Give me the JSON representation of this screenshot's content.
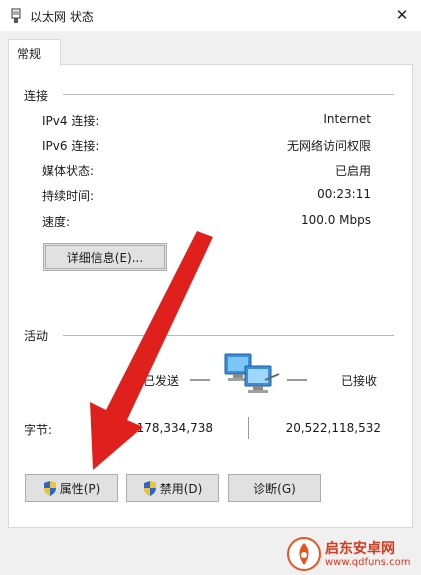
{
  "window": {
    "title": "以太网 状态",
    "close_glyph": "✕"
  },
  "tabs": [
    {
      "label": "常规"
    }
  ],
  "connection": {
    "heading": "连接",
    "rows": [
      {
        "label": "IPv4 连接:",
        "value": "Internet"
      },
      {
        "label": "IPv6 连接:",
        "value": "无网络访问权限"
      },
      {
        "label": "媒体状态:",
        "value": "已启用"
      },
      {
        "label": "持续时间:",
        "value": "00:23:11"
      },
      {
        "label": "速度:",
        "value": "100.0 Mbps"
      }
    ],
    "details_button": "详细信息(E)..."
  },
  "activity": {
    "heading": "活动",
    "sent_label": "已发送",
    "received_label": "已接收",
    "bytes_label": "字节:",
    "bytes_sent": "9,178,334,738",
    "bytes_received": "20,522,118,532"
  },
  "buttons": {
    "properties": "属性(P)",
    "disable": "禁用(D)",
    "diagnose": "诊断(G)"
  },
  "icons": {
    "title": "network-adapter-icon",
    "activity": "network-computers-icon",
    "shield": "uac-shield-icon"
  },
  "annotation": {
    "arrow_color": "#e0201c"
  },
  "watermark": {
    "name": "启东安卓网",
    "url": "www.qdfuns.com"
  }
}
